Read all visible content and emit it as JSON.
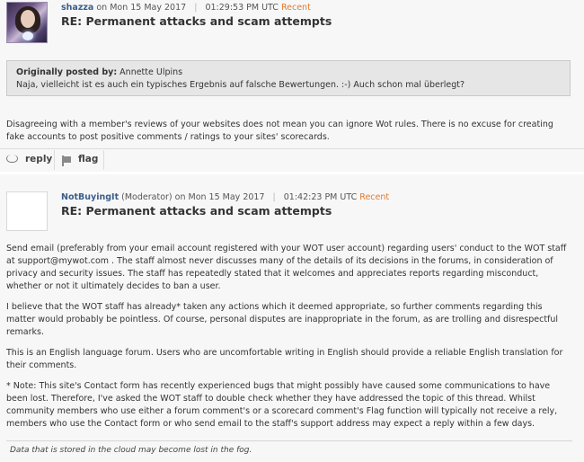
{
  "post1": {
    "author": "shazza",
    "date_prefix": "on Mon 15 May 2017",
    "time": "01:29:53 PM UTC",
    "recent": "Recent",
    "title": "RE: Permanent attacks and scam attempts",
    "quote": {
      "label": "Originally posted by:",
      "author": "Annette Ulpins",
      "text": "Naja, vielleicht ist es auch ein typisches Ergebnis auf falsche Bewertungen. :-) Auch schon mal überlegt?"
    },
    "body": "Disagreeing with a member's reviews of your websites does not mean you can ignore Wot rules. There is no excuse for creating fake accounts to post positive comments / ratings to your sites' scorecards.",
    "actions": {
      "reply": "reply",
      "flag": "flag"
    }
  },
  "post2": {
    "author": "NotBuyingIt",
    "role_date": "(Moderator) on Mon 15 May 2017",
    "time": "01:42:23 PM UTC",
    "recent": "Recent",
    "title": "RE: Permanent attacks and scam attempts",
    "paragraphs": [
      "Send email (preferably from your email account registered with your WOT user account) regarding users' conduct to the WOT staff at support@mywot.com . The staff almost never discusses many of the details of its decisions in the forums, in consideration of privacy and security issues. The staff has repeatedly stated that it welcomes and appreciates reports regarding misconduct, whether or not it ultimately decides to ban a user.",
      "I believe that the WOT staff has already* taken any actions which it deemed appropriate, so further comments regarding this matter would probably be pointless. Of course, personal disputes are inappropriate in the forum, as are trolling and disrespectful remarks.",
      "This is an English language forum. Users who are uncomfortable writing in English should provide a reliable English translation for their comments.",
      "* Note: This site's Contact form has recently experienced bugs that might possibly have caused some communications to have been lost. Therefore, I've asked the WOT staff to double check whether they have addressed the topic of this thread. Whilst community members who use either a forum comment's or a scorecard comment's Flag function will typically not receive a rely, members who use the Contact form or who send email to the staff's support address may expect a reply within a few days."
    ],
    "signature": "Data that is stored in the cloud may become lost in the fog."
  }
}
